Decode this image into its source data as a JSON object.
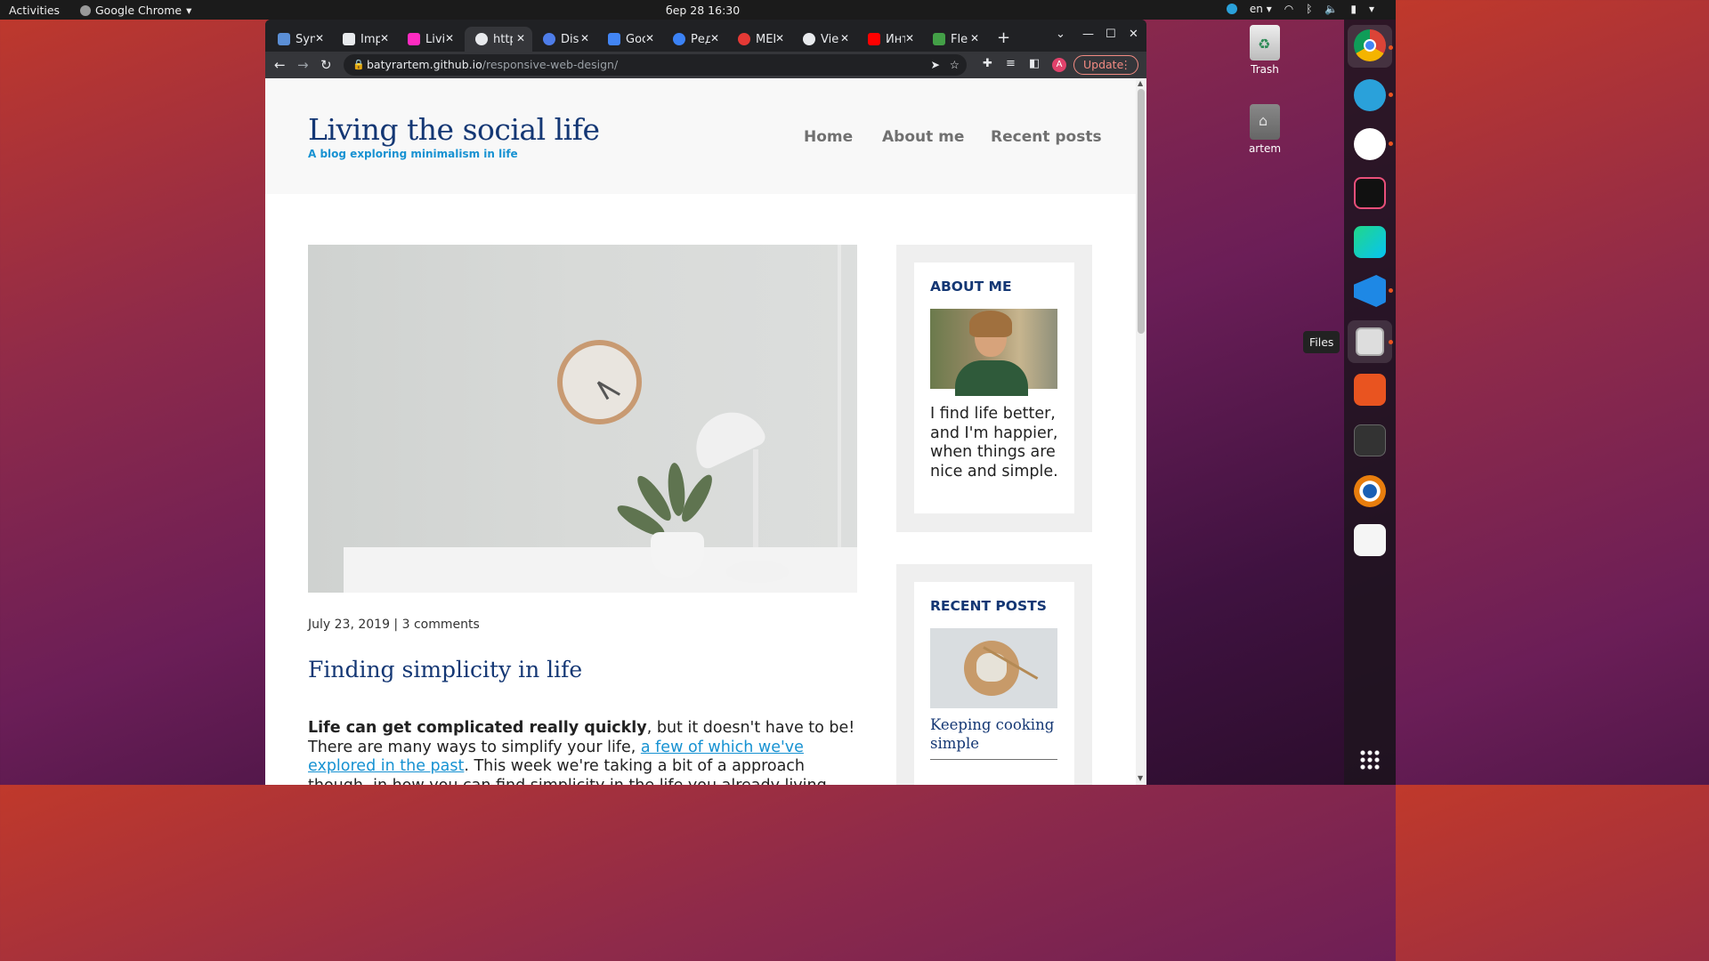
{
  "topbar": {
    "activities": "Activities",
    "app_name": "Google Chrome",
    "clock": "бер 28  16:30",
    "lang": "en"
  },
  "desktop": {
    "trash_label": "Trash",
    "home_label": "artem"
  },
  "dock": {
    "tooltip": "Files",
    "items": [
      "chrome-icon",
      "telegram-icon",
      "ms-authenticator-icon",
      "intellij-icon",
      "webstorm-icon",
      "vscode-icon",
      "files-icon",
      "software-icon",
      "terminal-icon",
      "blender-icon",
      "text-editor-icon"
    ]
  },
  "browser": {
    "tabs": [
      {
        "title": "Syn",
        "color": "#5b8fd6"
      },
      {
        "title": "Imp",
        "color": "#e8eaed"
      },
      {
        "title": "Livi",
        "color": "#ff2bc2"
      },
      {
        "title": "http",
        "color": "#e8eaed"
      },
      {
        "title": "Dis",
        "color": "#4e7de9"
      },
      {
        "title": "Goo",
        "color": "#4285f4"
      },
      {
        "title": "Ред",
        "color": "#3b82f6"
      },
      {
        "title": "MEI",
        "color": "#e53935"
      },
      {
        "title": "Vie",
        "color": "#e8eaed"
      },
      {
        "title": "Инт",
        "color": "#ff0000"
      },
      {
        "title": "Fle",
        "color": "#43a047"
      }
    ],
    "url_host": "batyrartem.github.io",
    "url_path": "/responsive-web-design/",
    "update_label": "Update",
    "profile_initial": "A"
  },
  "site": {
    "title": "Living the social life",
    "subtitle": "A blog exploring minimalism in life",
    "nav": [
      "Home",
      "About me",
      "Recent posts"
    ],
    "post": {
      "meta": "July 23, 2019 | 3 comments",
      "title": "Finding simplicity in life",
      "body_bold": "Life can get complicated really quickly",
      "body_1": ", but it doesn't have to be! There are many ways to simplify your life, ",
      "body_link": "a few of which we've explored in the past",
      "body_2": ". This week we're taking a bit of a approach though, in how you can find simplicity in the life you already living."
    },
    "about": {
      "heading": "ABOUT ME",
      "text": "I find life better, and I'm happier, when things are nice and simple."
    },
    "recent": {
      "heading": "RECENT POSTS",
      "post_title": "Keeping cooking simple"
    }
  },
  "colors": {
    "brand_dark": "#143774",
    "brand_light": "#1792d2",
    "nav_gray": "#707070"
  }
}
